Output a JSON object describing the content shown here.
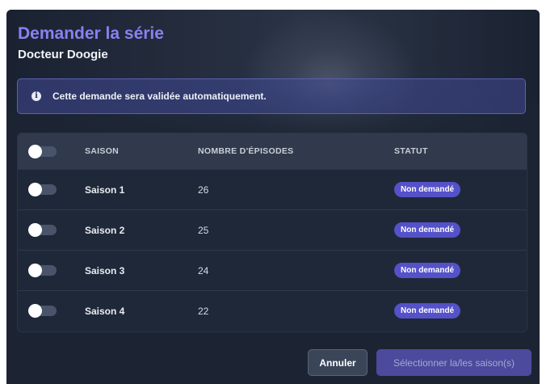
{
  "dialog": {
    "title": "Demander la série",
    "subtitle": "Docteur Doogie"
  },
  "alert": {
    "icon": "info-icon",
    "text": "Cette demande sera validée automatiquement."
  },
  "table": {
    "columns": [
      "SAISON",
      "NOMBRE D'ÉPISODES",
      "STATUT"
    ],
    "select_all_toggle": false,
    "rows": [
      {
        "season": "Saison 1",
        "episodes": "26",
        "status": "Non demandé",
        "selected": false
      },
      {
        "season": "Saison 2",
        "episodes": "25",
        "status": "Non demandé",
        "selected": false
      },
      {
        "season": "Saison 3",
        "episodes": "24",
        "status": "Non demandé",
        "selected": false
      },
      {
        "season": "Saison 4",
        "episodes": "22",
        "status": "Non demandé",
        "selected": false
      }
    ]
  },
  "footer": {
    "cancel_label": "Annuler",
    "submit_label": "Sélectionner la/les saison(s)"
  },
  "colors": {
    "accent": "#8a80f2",
    "badge": "#5451c9",
    "background": "#1c2433"
  }
}
